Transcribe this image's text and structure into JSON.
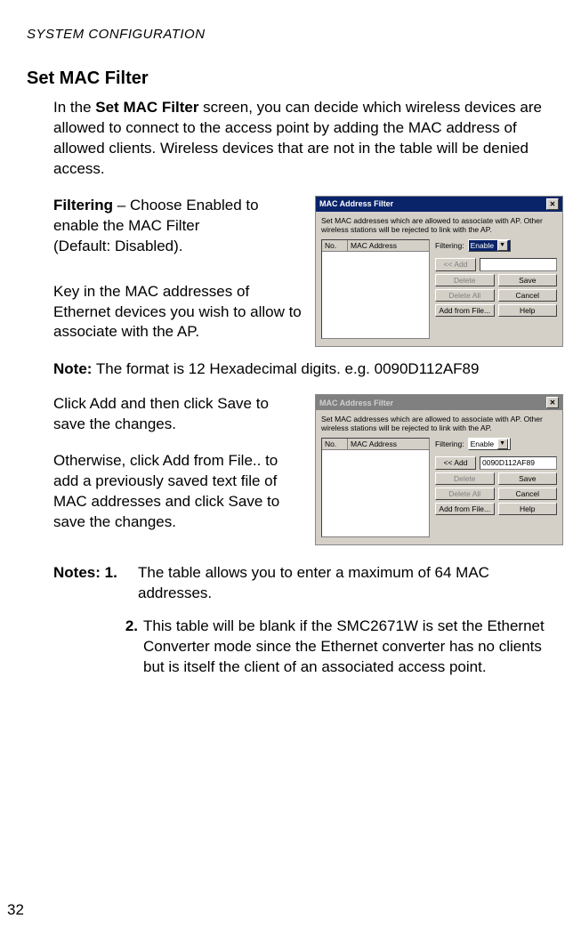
{
  "running_head": "SYSTEM CONFIGURATION",
  "section_title": "Set MAC Filter",
  "intro": "In the Set MAC Filter screen, you can decide which wireless devices are allowed to connect to the access point by adding the MAC address of allowed clients. Wireless devices that are not in the table will be denied access.",
  "intro_bold": "Set MAC Filter",
  "filtering_label": "Filtering",
  "filtering_desc_1": " – Choose Enabled to enable the MAC Filter",
  "filtering_desc_2": "(Default: Disabled).",
  "keyin_para": "Key in the MAC addresses of Ethernet devices you wish to allow to associate with the AP.",
  "note_label": "Note:",
  "note_text": " The format is 12 Hexadecimal digits. e.g. 0090D112AF89",
  "click_para_1": "Click Add and then click Save to save the changes.",
  "click_para_2": "Otherwise, click Add from File.. to add a previously saved text file of MAC addresses and click Save to save the changes.",
  "notes_label_1": "Notes: 1.",
  "notes_text_1": "The table allows you to enter a maximum of 64 MAC addresses.",
  "notes_label_2": "2.",
  "notes_text_2": "This table will be blank if the SMC2671W is set the Ethernet Converter mode since the Ethernet converter has no clients but is itself the client of an associated access point.",
  "page_number": "32",
  "dialog": {
    "title": "MAC Address Filter",
    "instr": "Set MAC addresses which are allowed to associate with AP. Other wireless stations will be rejected to link with the AP.",
    "col_no": "No.",
    "col_mac": "MAC Address",
    "filtering_lbl": "Filtering:",
    "filtering_val": "Enable",
    "btn_add": "<< Add",
    "btn_delete": "Delete",
    "btn_save": "Save",
    "btn_delete_all": "Delete All",
    "btn_cancel": "Cancel",
    "btn_add_file": "Add from File...",
    "btn_help": "Help",
    "input_empty": "",
    "input_sample": "0090D112AF89"
  }
}
